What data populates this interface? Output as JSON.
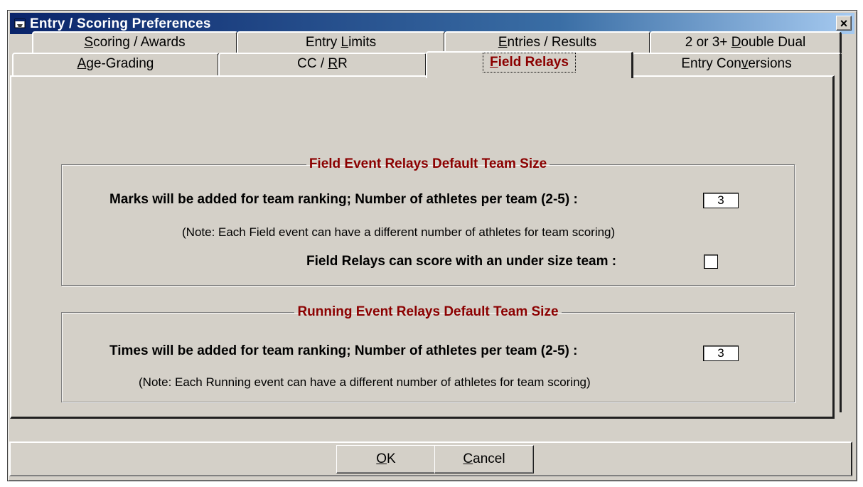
{
  "window": {
    "title": "Entry / Scoring Preferences",
    "close_label": "×"
  },
  "tabs_row1": [
    {
      "pre": "",
      "u": "S",
      "post": "coring / Awards"
    },
    {
      "pre": "Entry ",
      "u": "L",
      "post": "imits"
    },
    {
      "pre": "",
      "u": "E",
      "post": "ntries / Results"
    },
    {
      "pre": "2 or 3+ ",
      "u": "D",
      "post": "ouble Dual"
    }
  ],
  "tabs_row2": [
    {
      "pre": "",
      "u": "A",
      "post": "ge-Grading"
    },
    {
      "pre": "CC / ",
      "u": "R",
      "post": "R"
    },
    {
      "pre": "",
      "u": "F",
      "post": "ield Relays"
    },
    {
      "pre": "Entry Con",
      "u": "v",
      "post": "ersions"
    }
  ],
  "field_group": {
    "legend": "Field Event Relays Default Team Size",
    "marks_label": "Marks will be added for team ranking; Number of athletes per team (2-5) :",
    "marks_value": "3",
    "note": "(Note: Each Field event can have a different number of athletes for team scoring)",
    "undersize_label": "Field Relays can score with an under size team :",
    "undersize_checked": false
  },
  "running_group": {
    "legend": "Running Event Relays Default Team Size",
    "times_label": "Times will be added for team ranking; Number of athletes per team (2-5) :",
    "times_value": "3",
    "note": "(Note: Each Running event can have a different number of athletes for team scoring)"
  },
  "buttons": {
    "ok": {
      "u": "O",
      "post": "K"
    },
    "cancel": {
      "u": "C",
      "post": "ancel"
    }
  },
  "colors": {
    "face": "#d4d0c8",
    "accent_red": "#8b0000",
    "title_gradient_start": "#0a246a",
    "title_gradient_end": "#a6caf0"
  }
}
